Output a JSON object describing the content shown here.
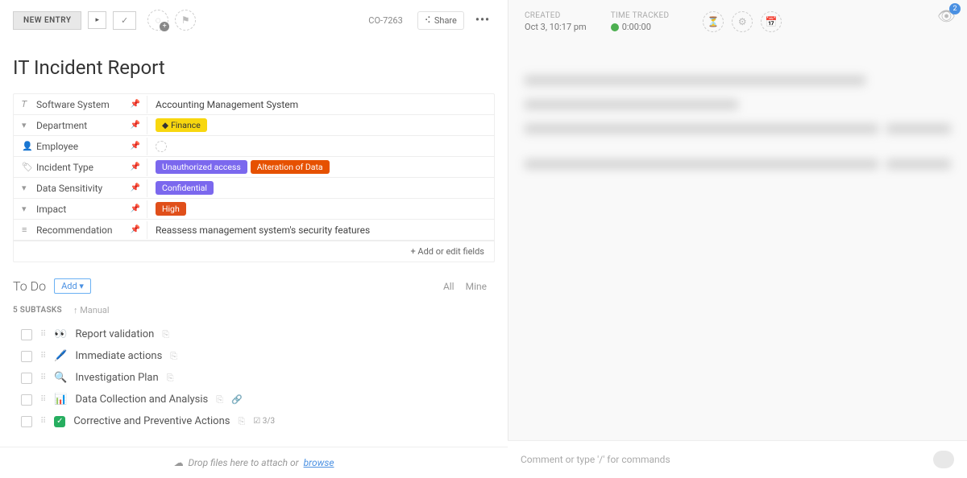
{
  "topbar": {
    "new_entry": "NEW ENTRY",
    "task_id": "CO-7263",
    "share": "Share"
  },
  "title": "IT Incident Report",
  "fields": {
    "software_system": {
      "label": "Software System",
      "value": "Accounting Management System"
    },
    "department": {
      "label": "Department",
      "tag": "Finance"
    },
    "employee": {
      "label": "Employee"
    },
    "incident_type": {
      "label": "Incident Type",
      "tag1": "Unauthorized access",
      "tag2": "Alteration of Data"
    },
    "data_sensitivity": {
      "label": "Data Sensitivity",
      "tag": "Confidential"
    },
    "impact": {
      "label": "Impact",
      "tag": "High"
    },
    "recommendation": {
      "label": "Recommendation",
      "value": "Reassess management system's security features"
    },
    "add_edit": "+ Add or edit fields"
  },
  "todo": {
    "title": "To Do",
    "add": "Add",
    "filter_all": "All",
    "filter_mine": "Mine"
  },
  "subtasks": {
    "count_label": "5 SUBTASKS",
    "sort": "Manual",
    "items": [
      {
        "emoji": "👀",
        "title": "Report validation"
      },
      {
        "emoji": "🖊️",
        "title": "Immediate actions"
      },
      {
        "emoji": "🔍",
        "title": "Investigation Plan"
      },
      {
        "emoji": "📊",
        "title": "Data Collection and Analysis"
      },
      {
        "emoji": "✅",
        "title": "Corrective and Preventive Actions",
        "done": true,
        "progress": "3/3"
      }
    ]
  },
  "right": {
    "created_label": "CREATED",
    "created_value": "Oct 3, 10:17 pm",
    "time_label": "TIME TRACKED",
    "time_value": "0:00:00",
    "notif_count": "2"
  },
  "bottom": {
    "drop_text": "Drop files here to attach or ",
    "browse": "browse",
    "comment_placeholder": "Comment or type '/' for commands"
  }
}
